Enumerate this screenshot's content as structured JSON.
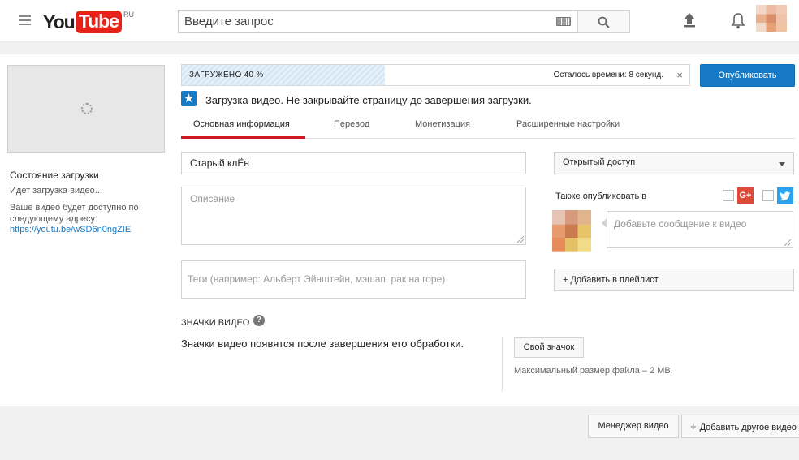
{
  "header": {
    "logo_you": "You",
    "logo_tube": "Tube",
    "logo_region": "RU",
    "search_placeholder": "Введите запрос"
  },
  "sidebar": {
    "status_title": "Состояние загрузки",
    "status_text": "Идет загрузка видео...",
    "address_note": "Ваше видео будет доступно по следующему адресу:",
    "video_link": "https://youtu.be/wSD6n0ngZIE"
  },
  "upload": {
    "progress_label": "ЗАГРУЖЕНО 40 %",
    "progress_fraction": 0.4,
    "time_left": "Осталось времени: 8 секунд.",
    "close_symbol": "×",
    "publish_label": "Опубликовать",
    "notice_text": "Загрузка видео. Не закрывайте страницу до завершения загрузки."
  },
  "tabs": [
    {
      "label": "Основная информация"
    },
    {
      "label": "Перевод"
    },
    {
      "label": "Монетизация"
    },
    {
      "label": "Расширенные настройки"
    }
  ],
  "form": {
    "title_value": "Старый клЁн",
    "description_placeholder": "Описание",
    "tags_placeholder": "Теги (например: Альберт Эйнштейн, мэшап, рак на горе)",
    "access_value": "Открытый доступ",
    "also_publish_label": "Также опубликовать в",
    "gplus_label": "G+",
    "message_placeholder": "Добавьте сообщение к видео",
    "playlist_label": "+ Добавить в плейлист"
  },
  "thumbnails": {
    "title": "ЗНАЧКИ ВИДЕО",
    "help_symbol": "?",
    "note": "Значки видео появятся после завершения его обработки.",
    "custom_button": "Свой значок",
    "max_size": "Максимальный размер файла – 2 МВ."
  },
  "footer": {
    "video_manager": "Менеджер видео",
    "add_video": "Добавить другое видео"
  },
  "colors": {
    "brand_red": "#e62117",
    "accent_blue": "#167ac6",
    "tab_underline": "#cc181e"
  }
}
